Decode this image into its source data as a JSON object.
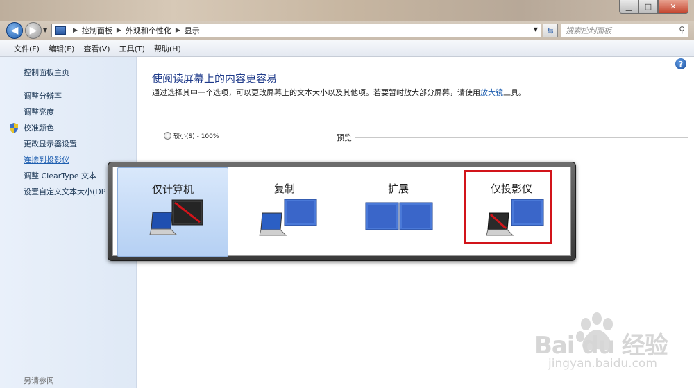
{
  "window": {
    "minimize_glyph": "▁",
    "maximize_glyph": "□",
    "close_glyph": "✕"
  },
  "address": {
    "crumbs": [
      "控制面板",
      "外观和个性化",
      "显示"
    ],
    "search_placeholder": "搜索控制面板"
  },
  "menu": [
    "文件(F)",
    "编辑(E)",
    "查看(V)",
    "工具(T)",
    "帮助(H)"
  ],
  "sidebar": {
    "items": [
      {
        "label": "控制面板主页"
      },
      {
        "label": "调整分辨率"
      },
      {
        "label": "调整亮度"
      },
      {
        "label": "校准颜色"
      },
      {
        "label": "更改显示器设置"
      },
      {
        "label": "连接到投影仪"
      },
      {
        "label": "调整 ClearType 文本"
      },
      {
        "label": "设置自定义文本大小(DP"
      }
    ],
    "see_also": "另请参阅"
  },
  "main": {
    "title": "使阅读屏幕上的内容更容易",
    "desc_before": "通过选择其中一个选项，可以更改屏幕上的文本大小以及其他项。若要暂时放大部分屏幕，请使用",
    "desc_link": "放大镜",
    "desc_after": "工具。",
    "radio_small": "较小(S) - 100%",
    "preview_label": "预览"
  },
  "projector": {
    "options": [
      {
        "label": "仅计算机",
        "selected": true
      },
      {
        "label": "复制",
        "selected": false
      },
      {
        "label": "扩展",
        "selected": false
      },
      {
        "label": "仅投影仪",
        "selected": false,
        "highlighted": true
      }
    ],
    "highlight_color": "#d2141a"
  },
  "watermark": {
    "logo": "Bai du 经验",
    "url": "jingyan.baidu.com"
  }
}
